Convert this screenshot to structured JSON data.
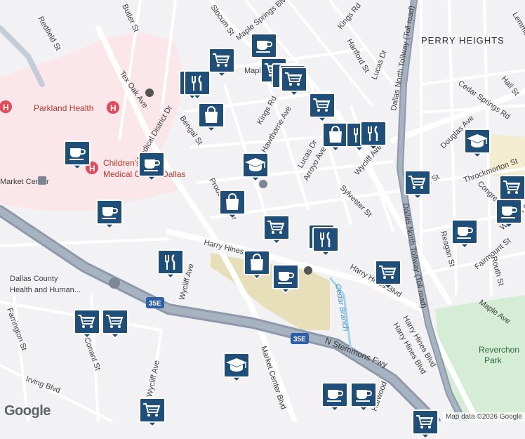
{
  "map": {
    "attribution": "Map data ©2026 Google",
    "logo": "Google",
    "colors": {
      "land": "#f2f1f4",
      "medical": "#fbe7ea",
      "park": "#d5ecd5",
      "plaza": "#e6dfb9",
      "road": "#ffffff",
      "highway": "#8e9aab",
      "water": "#9fd2ef",
      "marker": "#1f4e79"
    },
    "area_labels": [
      {
        "text": "PERRY HEIGHTS"
      }
    ],
    "poi_labels": [
      {
        "text": "Parkland Health"
      },
      {
        "text": "Children's"
      },
      {
        "text": "Medical Center Dallas"
      },
      {
        "text": "Dallas County"
      },
      {
        "text": "Health and Human..."
      },
      {
        "text": "Market Center"
      }
    ],
    "park_labels": [
      {
        "text": "Reverchon"
      },
      {
        "text": "Park"
      }
    ],
    "water_labels": [
      {
        "text": "Cedar Branch"
      }
    ],
    "highway_shields": [
      "35E",
      "35E"
    ],
    "street_labels": [
      "Redfield St",
      "Butler St",
      "Maple Springs Blvd",
      "Kings Rd",
      "Hartford St",
      "Lucas Dr",
      "Maple Ave",
      "Tex Oak Ave",
      "Medical District Dr",
      "Bengal St",
      "Kings Rd",
      "Hawthorne Ave",
      "Lucas Dr",
      "Arroyo Ave",
      "Wycliff Ave",
      "Dallas North Tollway (Toll road)",
      "Cedar Springs Rd",
      "Douglas Ave",
      "Throckmorton St",
      "Congress Ave",
      "Knight St",
      "Sylvester St",
      "Reagan St",
      "Welborn St",
      "Routh St",
      "Fairmount St",
      "Harry Hines Blvd",
      "Harry Hines Blvd",
      "Harry Hines Blvd",
      "Production Dr",
      "Wycliff Ave",
      "Farrington St",
      "Conant St",
      "Irving Blvd",
      "Wycliff Ave",
      "Market Center Blvd",
      "N Stemmons Fwy",
      "Maple Ave",
      "Dallas North Tollway (Toll road)",
      "Hall St",
      "Lemmon Ave",
      "Harry Hines Blvd",
      "Harwood",
      "Slocum St"
    ],
    "markers": [
      {
        "type": "coffee",
        "icon": "coffee-cup-icon"
      },
      {
        "type": "grocery",
        "icon": "shopping-cart-icon"
      },
      {
        "type": "grocery",
        "icon": "shopping-cart-icon"
      },
      {
        "type": "restaurant",
        "icon": "fork-knife-icon"
      },
      {
        "type": "restaurant",
        "icon": "fork-knife-icon"
      },
      {
        "type": "restaurant",
        "icon": "fork-knife-icon"
      },
      {
        "type": "grocery",
        "icon": "shopping-cart-icon"
      },
      {
        "type": "restaurant",
        "icon": "fork-knife-icon"
      },
      {
        "type": "shopping",
        "icon": "shopping-bag-icon"
      },
      {
        "type": "grocery",
        "icon": "shopping-cart-icon"
      },
      {
        "type": "shopping",
        "icon": "shopping-bag-icon"
      },
      {
        "type": "restaurant",
        "icon": "fork-knife-icon"
      },
      {
        "type": "restaurant",
        "icon": "fork-knife-icon"
      },
      {
        "type": "coffee",
        "icon": "coffee-cup-icon"
      },
      {
        "type": "coffee",
        "icon": "coffee-cup-icon"
      },
      {
        "type": "school",
        "icon": "graduation-cap-icon"
      },
      {
        "type": "grocery",
        "icon": "shopping-cart-icon"
      },
      {
        "type": "school",
        "icon": "graduation-cap-icon"
      },
      {
        "type": "grocery",
        "icon": "shopping-cart-icon"
      },
      {
        "type": "coffee",
        "icon": "coffee-cup-icon"
      },
      {
        "type": "shopping",
        "icon": "shopping-bag-icon"
      },
      {
        "type": "coffee",
        "icon": "coffee-cup-icon"
      },
      {
        "type": "grocery",
        "icon": "shopping-cart-icon"
      },
      {
        "type": "restaurant",
        "icon": "fork-knife-icon"
      },
      {
        "type": "restaurant",
        "icon": "fork-knife-icon"
      },
      {
        "type": "coffee",
        "icon": "coffee-cup-icon"
      },
      {
        "type": "shopping",
        "icon": "shopping-bag-icon"
      },
      {
        "type": "coffee",
        "icon": "coffee-cup-icon"
      },
      {
        "type": "restaurant",
        "icon": "fork-knife-icon"
      },
      {
        "type": "grocery",
        "icon": "shopping-cart-icon"
      },
      {
        "type": "grocery",
        "icon": "shopping-cart-icon"
      },
      {
        "type": "grocery",
        "icon": "shopping-cart-icon"
      },
      {
        "type": "school",
        "icon": "graduation-cap-icon"
      },
      {
        "type": "coffee",
        "icon": "coffee-cup-icon"
      },
      {
        "type": "coffee",
        "icon": "coffee-cup-icon"
      },
      {
        "type": "grocery",
        "icon": "shopping-cart-icon"
      },
      {
        "type": "grocery",
        "icon": "shopping-cart-icon"
      }
    ]
  }
}
